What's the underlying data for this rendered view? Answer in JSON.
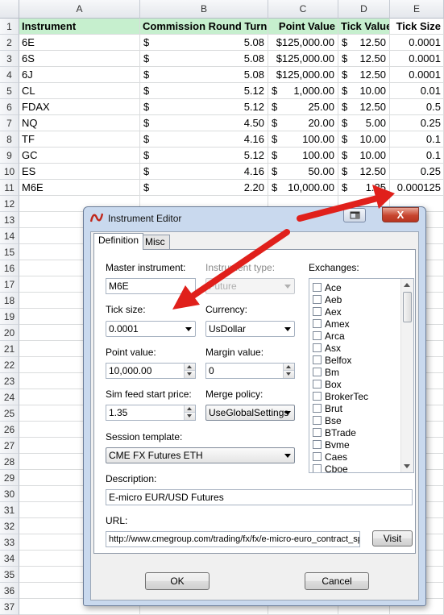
{
  "spreadsheet": {
    "columns": [
      "A",
      "B",
      "C",
      "D",
      "E"
    ],
    "row_numbers": [
      "1",
      "2",
      "3",
      "4",
      "5",
      "6",
      "7",
      "8",
      "9",
      "10",
      "11",
      "12",
      "13",
      "14",
      "15",
      "16",
      "17",
      "18",
      "19",
      "20",
      "21",
      "22",
      "23",
      "24",
      "25",
      "26",
      "27",
      "28",
      "29",
      "30",
      "31",
      "32",
      "33",
      "34",
      "35",
      "36",
      "37"
    ],
    "headers": [
      "Instrument",
      "Commission Round Turn",
      "Point Value",
      "Tick Value",
      "Tick Size"
    ],
    "currency_symbol": "$",
    "rows": [
      {
        "instrument": "6E",
        "commission": "5.08",
        "point_value": "$125,000.00",
        "tick_value": "12.50",
        "tick_size": "0.0001"
      },
      {
        "instrument": "6S",
        "commission": "5.08",
        "point_value": "$125,000.00",
        "tick_value": "12.50",
        "tick_size": "0.0001"
      },
      {
        "instrument": "6J",
        "commission": "5.08",
        "point_value": "$125,000.00",
        "tick_value": "12.50",
        "tick_size": "0.0001"
      },
      {
        "instrument": "CL",
        "commission": "5.12",
        "point_value": "1,000.00",
        "tick_value": "10.00",
        "tick_size": "0.01"
      },
      {
        "instrument": "FDAX",
        "commission": "5.12",
        "point_value": "25.00",
        "tick_value": "12.50",
        "tick_size": "0.5"
      },
      {
        "instrument": "NQ",
        "commission": "4.50",
        "point_value": "20.00",
        "tick_value": "5.00",
        "tick_size": "0.25"
      },
      {
        "instrument": "TF",
        "commission": "4.16",
        "point_value": "100.00",
        "tick_value": "10.00",
        "tick_size": "0.1"
      },
      {
        "instrument": "GC",
        "commission": "5.12",
        "point_value": "100.00",
        "tick_value": "10.00",
        "tick_size": "0.1"
      },
      {
        "instrument": "ES",
        "commission": "4.16",
        "point_value": "50.00",
        "tick_value": "12.50",
        "tick_size": "0.25"
      },
      {
        "instrument": "M6E",
        "commission": "2.20",
        "point_value": "10,000.00",
        "tick_value": "1.25",
        "tick_size": "0.000125"
      }
    ]
  },
  "dialog": {
    "title": "Instrument Editor",
    "close_label": "X",
    "tabs": [
      "Definition",
      "Misc"
    ],
    "master_instrument": {
      "label": "Master instrument:",
      "value": "M6E"
    },
    "instrument_type": {
      "label": "Instrument type:",
      "value": "Future"
    },
    "tick_size": {
      "label": "Tick size:",
      "value": "0.0001"
    },
    "currency": {
      "label": "Currency:",
      "value": "UsDollar"
    },
    "point_value": {
      "label": "Point value:",
      "value": "10,000.00"
    },
    "margin_value": {
      "label": "Margin value:",
      "value": "0"
    },
    "sim_feed_start_price": {
      "label": "Sim feed start price:",
      "value": "1.35"
    },
    "merge_policy": {
      "label": "Merge policy:",
      "value": "UseGlobalSettings"
    },
    "session_template": {
      "label": "Session template:",
      "value": "CME FX Futures ETH"
    },
    "description": {
      "label": "Description:",
      "value": "E-micro EUR/USD Futures"
    },
    "url": {
      "label": "URL:",
      "value": "http://www.cmegroup.com/trading/fx/fx/e-micro-euro_contract_sp",
      "visit_label": "Visit"
    },
    "exchanges": {
      "label": "Exchanges:",
      "items": [
        "Ace",
        "Aeb",
        "Aex",
        "Amex",
        "Arca",
        "Asx",
        "Belfox",
        "Bm",
        "Box",
        "BrokerTec",
        "Brut",
        "Bse",
        "BTrade",
        "Bvme",
        "Caes",
        "Cboe"
      ]
    },
    "ok_label": "OK",
    "cancel_label": "Cancel"
  },
  "colors": {
    "header_fill": "#c6efce",
    "arrow": "#e0201b",
    "dialog_frame": "#c9d9ee",
    "close_button": "#c7452f"
  }
}
